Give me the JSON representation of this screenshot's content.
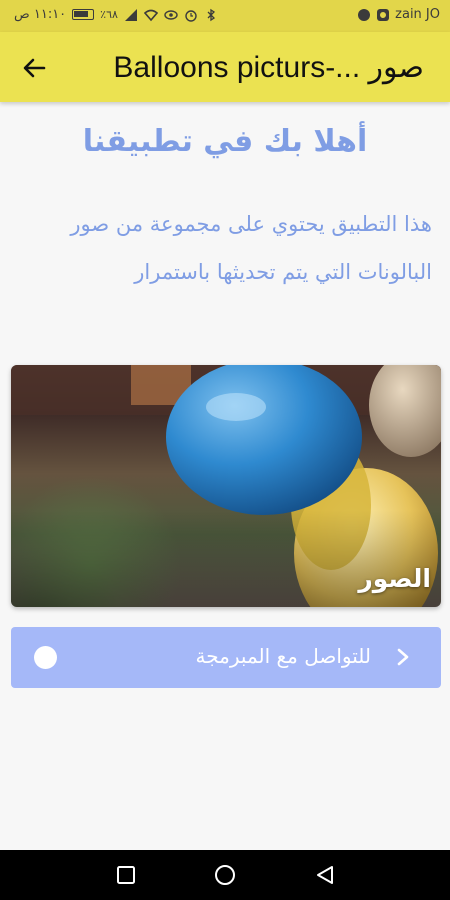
{
  "status_bar": {
    "carrier": "zain JO",
    "time": "١١:١٠ ص",
    "battery": "٪٦٨",
    "colors": {
      "background": "#e2d64a"
    },
    "icons": [
      "chat-bubble-icon",
      "app-notification-icon",
      "bluetooth-icon",
      "alarm-icon",
      "eye-icon",
      "wifi-icon",
      "signal-icon",
      "battery-icon"
    ]
  },
  "app_bar": {
    "title": "Balloons picturs-... صور",
    "back_icon": "arrow-left-icon",
    "colors": {
      "background": "#ebe251"
    }
  },
  "main": {
    "welcome": "أهلا بك في تطبيقنا",
    "description": "هذا التطبيق يحتوي على مجموعة من صور البالونات التي يتم تحديثها باستمرار",
    "card": {
      "caption": "الصور",
      "image": "balloons-photo"
    },
    "contact_button": {
      "label": "للتواصل مع المبرمجة",
      "icon": "chevron-right-icon",
      "indicator": "radio-dot"
    },
    "colors": {
      "text": "#7f9de4",
      "button": "#a5b8f8"
    }
  },
  "nav_bar": {
    "buttons": [
      "recents-square-icon",
      "home-circle-icon",
      "back-triangle-icon"
    ]
  }
}
